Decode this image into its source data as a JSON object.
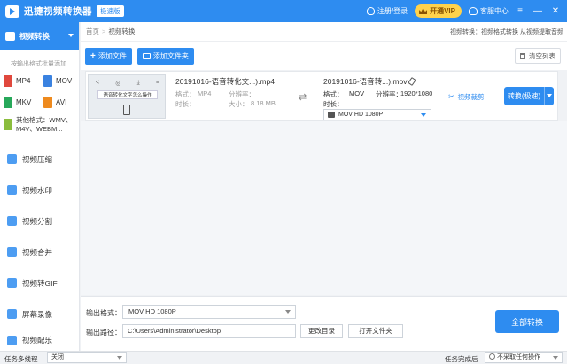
{
  "app": {
    "title": "迅捷视频转换器",
    "edition": "极速版",
    "login_label": "注册/登录",
    "vip_label": "开通VIP",
    "service_label": "客服中心",
    "menu_glyph": "≡",
    "minimize_glyph": "—",
    "close_glyph": "✕"
  },
  "sidebar": {
    "active_label": "视频转换",
    "hint": "按输出格式批量添加",
    "formats": [
      {
        "label": "MP4",
        "color": "#e0483d"
      },
      {
        "label": "MOV",
        "color": "#3a82e0"
      },
      {
        "label": "MKV",
        "color": "#27a85a"
      },
      {
        "label": "AVI",
        "color": "#ee8a1e"
      }
    ],
    "other_label": "其他格式：WMV、M4V、WEBM...",
    "other_color": "#8bbd3d",
    "items": [
      {
        "label": "视频压缩"
      },
      {
        "label": "视频水印"
      },
      {
        "label": "视频分割"
      },
      {
        "label": "视频合并"
      },
      {
        "label": "视频转GIF"
      },
      {
        "label": "屏幕录像"
      },
      {
        "label": "视频配乐"
      }
    ]
  },
  "breadcrumb": {
    "home": "首页",
    "sep": ">",
    "current": "视频转换",
    "info": "视频转换：视频格式转换 从视频提取音频"
  },
  "toolbar": {
    "add_file": "添加文件",
    "add_folder": "添加文件夹",
    "clear_list": "清空列表"
  },
  "file": {
    "thumbnail_title": "语音转化文字怎么操作",
    "thumb_icons": [
      "<",
      "◎",
      "⤓",
      "≡"
    ],
    "source_name": "20191016-语音转化文...).mp4",
    "format_label": "格式：",
    "format_value": "MP4",
    "resolution_label": "分辨率：",
    "resolution_value": "",
    "duration_label": "时长：",
    "duration_value": "",
    "size_label": "大小：",
    "size_value": "8.18 MB",
    "shuffle_glyph": "⇄",
    "target_name": "20191016-语音转...).mov",
    "target_format_label": "格式：",
    "target_format_value": "MOV",
    "target_resolution_label": "分辨率：",
    "target_resolution_value": "1920*1080",
    "target_duration_label": "时长：",
    "target_select_value": "MOV  HD 1080P",
    "clip_label": "视频裁剪",
    "convert_label": "转换(极速)"
  },
  "bottom": {
    "output_format_label": "输出格式：",
    "output_format_value": "MOV  HD 1080P",
    "output_path_label": "输出路径：",
    "output_path_value": "C:\\Users\\Administrator\\Desktop",
    "change_dir": "更改目录",
    "open_folder": "打开文件夹",
    "convert_all": "全部转换"
  },
  "status": {
    "thread_label": "任务多线程",
    "thread_value": "关闭",
    "after_label": "任务完成后",
    "after_value": "不采取任何操作"
  },
  "colors": {
    "accent": "#2e8cf0",
    "vip": "#ffd24c"
  }
}
